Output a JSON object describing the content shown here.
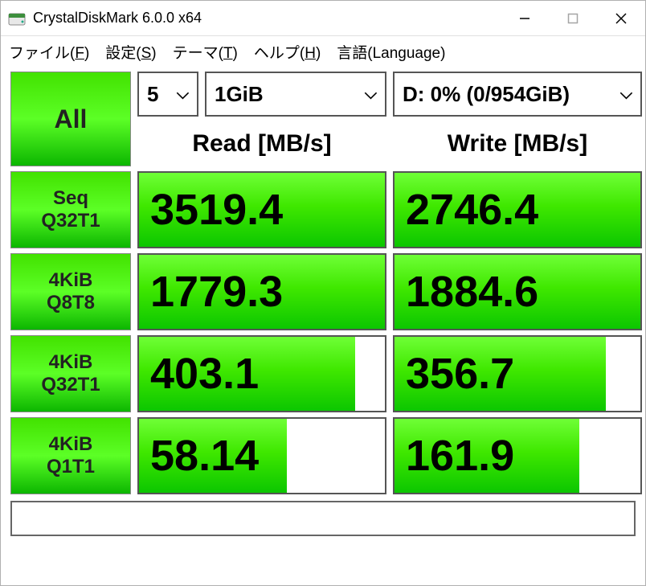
{
  "window": {
    "title": "CrystalDiskMark 6.0.0 x64"
  },
  "menu": {
    "file": "ファイル(F)",
    "settings": "設定(S)",
    "theme": "テーマ(T)",
    "help": "ヘルプ(H)",
    "language": "言語(Language)"
  },
  "controls": {
    "all_label": "All",
    "runs": "5",
    "size": "1GiB",
    "drive": "D: 0% (0/954GiB)"
  },
  "headers": {
    "read": "Read [MB/s]",
    "write": "Write [MB/s]"
  },
  "tests": [
    {
      "label1": "Seq",
      "label2": "Q32T1",
      "read": "3519.4",
      "read_pct": 100,
      "write": "2746.4",
      "write_pct": 100
    },
    {
      "label1": "4KiB",
      "label2": "Q8T8",
      "read": "1779.3",
      "read_pct": 100,
      "write": "1884.6",
      "write_pct": 100
    },
    {
      "label1": "4KiB",
      "label2": "Q32T1",
      "read": "403.1",
      "read_pct": 88,
      "write": "356.7",
      "write_pct": 86
    },
    {
      "label1": "4KiB",
      "label2": "Q1T1",
      "read": "58.14",
      "read_pct": 60,
      "write": "161.9",
      "write_pct": 75
    }
  ],
  "status": ""
}
